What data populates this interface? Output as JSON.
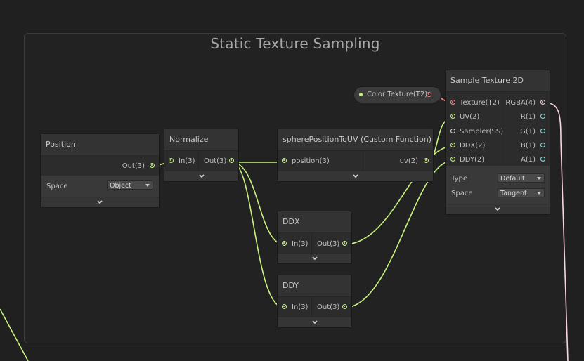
{
  "group": {
    "title": "Static Texture Sampling"
  },
  "property_pill": {
    "label": "Color Texture(T2)"
  },
  "position_node": {
    "title": "Position",
    "output": "Out(3)",
    "space_label": "Space",
    "space_value": "Object"
  },
  "normalize_node": {
    "title": "Normalize",
    "input": "In(3)",
    "output": "Out(3)"
  },
  "custom_fn_node": {
    "title": "spherePositionToUV (Custom Function)",
    "input": "position(3)",
    "output": "uv(2)"
  },
  "ddx_node": {
    "title": "DDX",
    "input": "In(3)",
    "output": "Out(3)"
  },
  "ddy_node": {
    "title": "DDY",
    "input": "In(3)",
    "output": "Out(3)"
  },
  "sample_node": {
    "title": "Sample Texture 2D",
    "inputs": [
      "Texture(T2)",
      "UV(2)",
      "Sampler(SS)",
      "DDX(2)",
      "DDY(2)"
    ],
    "outputs": [
      "RGBA(4)",
      "R(1)",
      "G(1)",
      "B(1)",
      "A(1)"
    ],
    "type_label": "Type",
    "type_value": "Default",
    "space_label": "Space",
    "space_value": "Tangent"
  },
  "colors": {
    "background": "#202020",
    "vector_wire": "#c8f27e",
    "vector4_wire": "#fbd2e6",
    "texture_port": "#ff8b8b",
    "float_port": "#84e4e7"
  }
}
